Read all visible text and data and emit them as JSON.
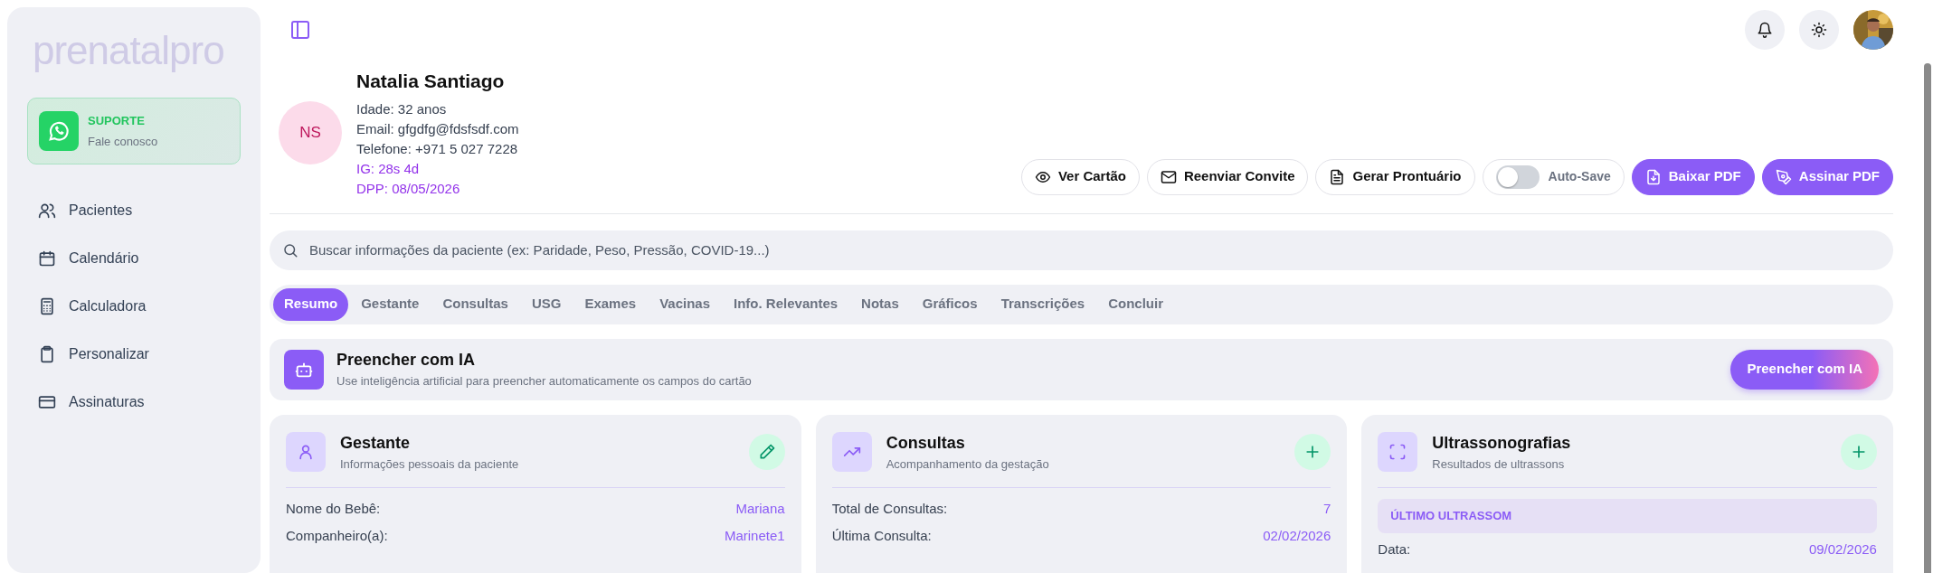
{
  "sidebar": {
    "logo": "prenatalpro",
    "support": {
      "title": "SUPORTE",
      "subtitle": "Fale conosco"
    },
    "items": [
      {
        "label": "Pacientes",
        "kind": "users"
      },
      {
        "label": "Calendário",
        "kind": "calendar"
      },
      {
        "label": "Calculadora",
        "kind": "calculator"
      },
      {
        "label": "Personalizar",
        "kind": "clipboard"
      },
      {
        "label": "Assinaturas",
        "kind": "card"
      }
    ]
  },
  "patient": {
    "initials": "NS",
    "name": "Natalia Santiago",
    "details": [
      "Idade: 32 anos",
      "Email: gfgdfg@fdsfsdf.com",
      "Telefone: +971 5 027 7228"
    ],
    "highlights": [
      "IG: 28s 4d",
      "DPP: 08/05/2026"
    ]
  },
  "actions": [
    {
      "label": "Ver Cartão",
      "kind": "eye"
    },
    {
      "label": "Reenviar Convite",
      "kind": "mail"
    },
    {
      "label": "Gerar Prontuário",
      "kind": "file"
    },
    {
      "label": "Auto-Save",
      "kind": "toggle",
      "on": false
    },
    {
      "label": "Baixar PDF",
      "kind": "download"
    },
    {
      "label": "Assinar PDF",
      "kind": "pen"
    }
  ],
  "search": {
    "placeholder": "Buscar informações da paciente (ex: Paridade, Peso, Pressão, COVID-19...)"
  },
  "tabs": [
    {
      "label": "Resumo",
      "selected": true
    },
    {
      "label": "Gestante",
      "selected": false
    },
    {
      "label": "Consultas",
      "selected": false
    },
    {
      "label": "USG",
      "selected": false
    },
    {
      "label": "Exames",
      "selected": false
    },
    {
      "label": "Vacinas",
      "selected": false
    },
    {
      "label": "Info. Relevantes",
      "selected": false
    },
    {
      "label": "Notas",
      "selected": false
    },
    {
      "label": "Gráficos",
      "selected": false
    },
    {
      "label": "Transcrições",
      "selected": false
    },
    {
      "label": "Concluir",
      "selected": false
    }
  ],
  "ai_panel": {
    "title": "Preencher com IA",
    "description": "Use inteligência artificial para preencher automaticamente os campos do cartão",
    "button": "Preencher com IA"
  },
  "cards": [
    {
      "title": "Gestante",
      "subtitle": "Informações pessoais da paciente",
      "kind": "person",
      "button": {
        "kind": "edit"
      },
      "rows": [
        {
          "label": "Nome do Bebê:",
          "value": "Mariana"
        },
        {
          "label": "Companheiro(a):",
          "value": "Marinete1"
        }
      ]
    },
    {
      "title": "Consultas",
      "subtitle": "Acompanhamento da gestação",
      "kind": "trend",
      "button": {
        "kind": "add"
      },
      "rows": [
        {
          "label": "Total de Consultas:",
          "value": "7"
        },
        {
          "label": "Última Consulta:",
          "value": "02/02/2026"
        }
      ]
    },
    {
      "title": "Ultrassonografias",
      "subtitle": "Resultados de ultrassons",
      "kind": "scan",
      "button": {
        "kind": "add"
      },
      "section": "ÚLTIMO ULTRASSOM",
      "rows": [
        {
          "label": "Data:",
          "value": "09/02/2026"
        }
      ]
    }
  ]
}
